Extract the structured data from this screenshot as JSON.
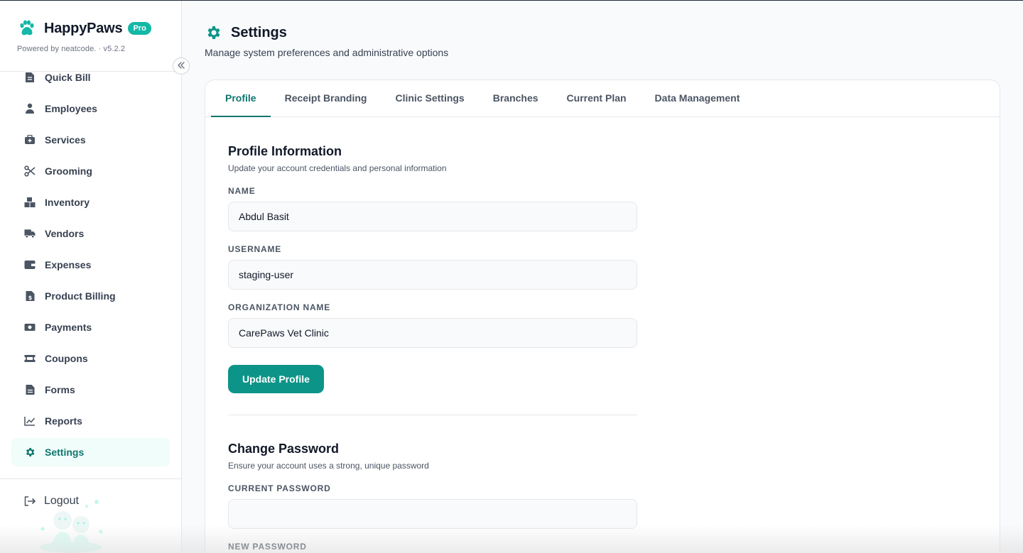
{
  "brand": {
    "name": "HappyPaws",
    "badge": "Pro",
    "powered_by": "Powered by neatcode. · v5.2.2"
  },
  "sidebar": {
    "items": [
      {
        "label": "Quick Bill",
        "icon": "document-icon",
        "active": false
      },
      {
        "label": "Employees",
        "icon": "user-icon",
        "active": false
      },
      {
        "label": "Services",
        "icon": "medical-bag-icon",
        "active": false
      },
      {
        "label": "Grooming",
        "icon": "scissors-icon",
        "active": false
      },
      {
        "label": "Inventory",
        "icon": "boxes-icon",
        "active": false
      },
      {
        "label": "Vendors",
        "icon": "truck-icon",
        "active": false
      },
      {
        "label": "Expenses",
        "icon": "wallet-icon",
        "active": false
      },
      {
        "label": "Product Billing",
        "icon": "invoice-icon",
        "active": false
      },
      {
        "label": "Payments",
        "icon": "money-icon",
        "active": false
      },
      {
        "label": "Coupons",
        "icon": "ticket-icon",
        "active": false
      },
      {
        "label": "Forms",
        "icon": "form-icon",
        "active": false
      },
      {
        "label": "Reports",
        "icon": "chart-line-icon",
        "active": false
      },
      {
        "label": "Settings",
        "icon": "gear-icon",
        "active": true
      }
    ],
    "logout_label": "Logout"
  },
  "header": {
    "title": "Settings",
    "subtitle": "Manage system preferences and administrative options"
  },
  "tabs": [
    {
      "label": "Profile",
      "active": true
    },
    {
      "label": "Receipt Branding",
      "active": false
    },
    {
      "label": "Clinic Settings",
      "active": false
    },
    {
      "label": "Branches",
      "active": false
    },
    {
      "label": "Current Plan",
      "active": false
    },
    {
      "label": "Data Management",
      "active": false
    }
  ],
  "profile": {
    "title": "Profile Information",
    "description": "Update your account credentials and personal information",
    "name_label": "NAME",
    "name_value": "Abdul Basit",
    "username_label": "USERNAME",
    "username_value": "staging-user",
    "org_label": "ORGANIZATION NAME",
    "org_value": "CarePaws Vet Clinic",
    "submit_label": "Update Profile"
  },
  "password": {
    "title": "Change Password",
    "description": "Ensure your account uses a strong, unique password",
    "current_label": "CURRENT PASSWORD",
    "current_value": "",
    "new_label": "NEW PASSWORD"
  },
  "colors": {
    "accent": "#0d9488",
    "accent_dark": "#0f766e",
    "active_bg": "#f0fdfa",
    "badge": "#14b8a6"
  }
}
